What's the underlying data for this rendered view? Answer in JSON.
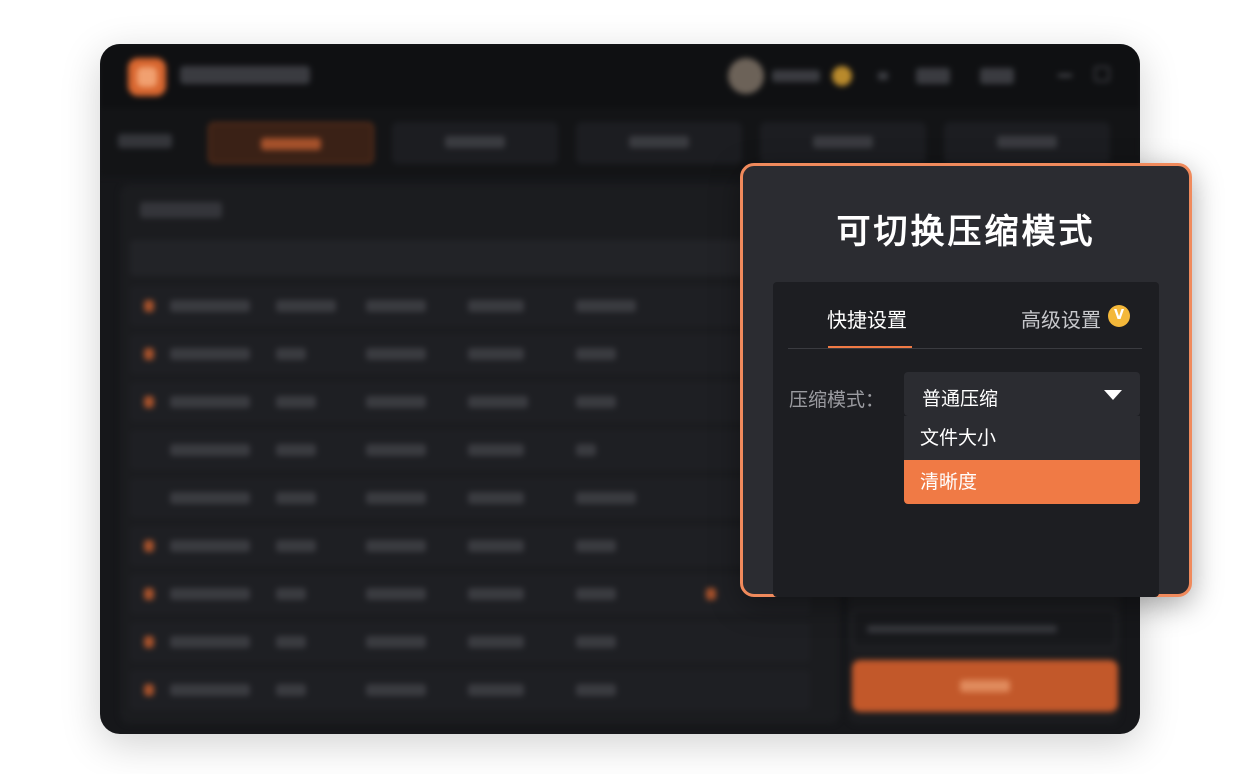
{
  "popup": {
    "title": "可切换压缩模式",
    "tabs": {
      "quick": "快捷设置",
      "advanced": "高级设置",
      "advanced_badge": "V"
    },
    "compress_mode": {
      "label": "压缩模式：",
      "selected": "普通压缩",
      "options": [
        "文件大小",
        "清晰度"
      ],
      "highlighted": "清晰度"
    }
  },
  "colors": {
    "accent": "#f07a45",
    "popup_border": "#f08a5c",
    "popup_bg": "#2b2c31",
    "vip_gold": "#f4b83a"
  }
}
